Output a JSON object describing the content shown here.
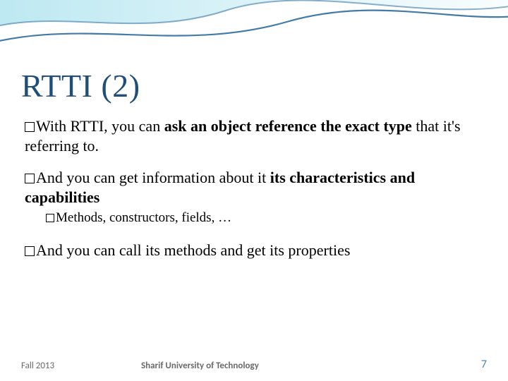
{
  "title": "RTTI (2)",
  "bullets": {
    "p1_a": "With RTTI, you can ",
    "p1_b_bold": "ask an object reference the exact type",
    "p1_c": " that it's referring to.",
    "p2_a": "And you can get information about it ",
    "p2_b_bold": "its characteristics and capabilities",
    "p3": "Methods, constructors, fields, …",
    "p4": "And you can call its methods and get its properties"
  },
  "footer": {
    "left": "Fall 2013",
    "center": "Sharif University of Technology",
    "page": "7"
  }
}
